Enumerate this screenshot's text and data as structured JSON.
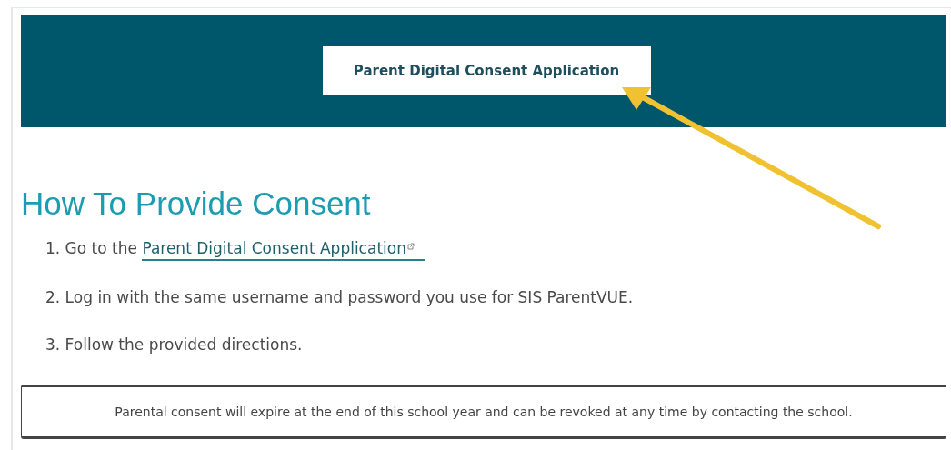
{
  "banner": {
    "button": "Parent Digital Consent Application"
  },
  "heading": "How To Provide Consent",
  "steps": [
    {
      "text": "1. Go to the",
      "link": "Parent Digital Consent Application"
    },
    {
      "text": "2. Log in with the same username and password you use for SIS ParentVUE."
    },
    {
      "text": "3. Follow the provided directions."
    }
  ],
  "note": "Parental consent will expire at the end of this school year and can be revoked at any time by contacting the school."
}
